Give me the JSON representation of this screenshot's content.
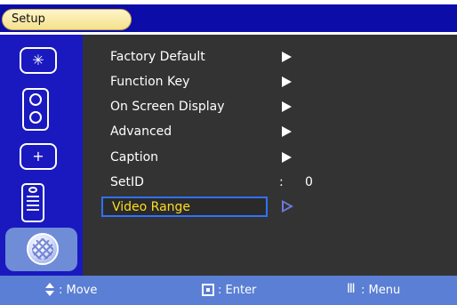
{
  "header": {
    "tab_title": "Setup"
  },
  "menu": {
    "items": [
      {
        "label": "Factory Default",
        "type": "submenu"
      },
      {
        "label": "Function Key",
        "type": "submenu"
      },
      {
        "label": "On Screen Display",
        "type": "submenu"
      },
      {
        "label": "Advanced",
        "type": "submenu"
      },
      {
        "label": "Caption",
        "type": "submenu"
      },
      {
        "label": "SetID",
        "type": "value",
        "separator": ":",
        "value": "0"
      },
      {
        "label": "Video Range",
        "type": "submenu",
        "selected": true
      }
    ]
  },
  "sidebar": {
    "icons": [
      {
        "name": "picture-icon"
      },
      {
        "name": "speaker-icon"
      },
      {
        "name": "plus-icon"
      },
      {
        "name": "remote-icon"
      },
      {
        "name": "globe-icon",
        "selected": true
      }
    ]
  },
  "footer": {
    "move": ": Move",
    "enter": ": Enter",
    "menu": ": Menu"
  },
  "colors": {
    "topbar": "#0c0ca8",
    "sidebar": "#1919bf",
    "main_bg": "#333333",
    "footer": "#5b7fd4",
    "selected_text": "#ffde1d",
    "selected_border": "#2f72ff"
  }
}
